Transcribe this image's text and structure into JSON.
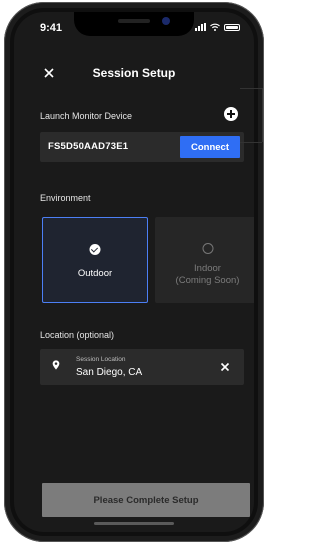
{
  "status": {
    "time": "9:41"
  },
  "header": {
    "title": "Session Setup"
  },
  "device": {
    "section_label": "Launch Monitor Device",
    "device_id": "FS5D50AAD73E1",
    "connect_label": "Connect"
  },
  "environment": {
    "section_label": "Environment",
    "outdoor_label": "Outdoor",
    "indoor_label_line1": "Indoor",
    "indoor_label_line2": "(Coming Soon)"
  },
  "location": {
    "section_label": "Location (optional)",
    "field_label": "Session Location",
    "value": "San Diego, CA"
  },
  "footer": {
    "complete_label": "Please Complete Setup"
  },
  "colors": {
    "accent": "#2f6ef4",
    "background": "#1a1a1a",
    "disabled_button": "#7c7c7c"
  },
  "icons": [
    "close-icon",
    "plus-icon",
    "check-circle-icon",
    "radio-empty-icon",
    "location-pin-icon",
    "clear-icon"
  ]
}
